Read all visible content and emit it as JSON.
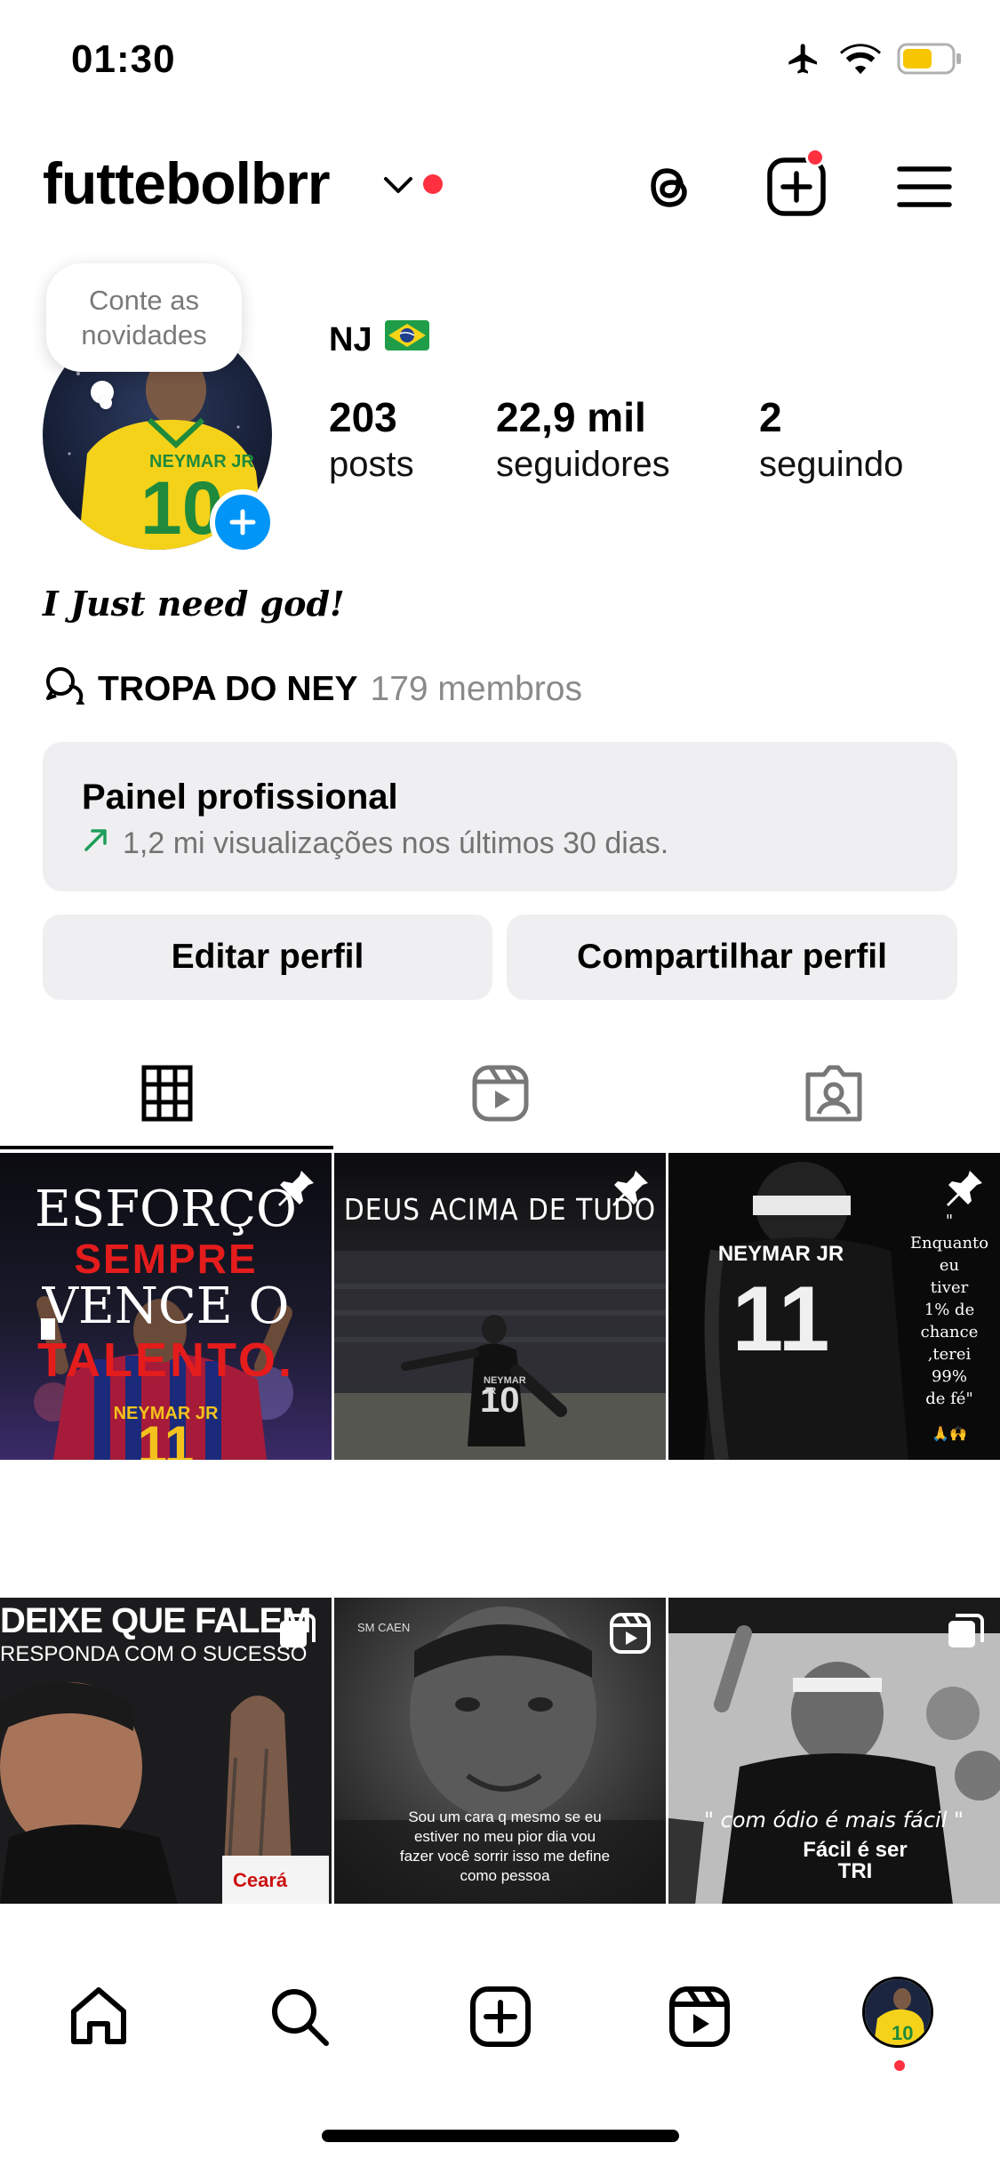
{
  "status_bar": {
    "time": "01:30",
    "icons": [
      "airplane-icon",
      "wifi-icon",
      "battery-icon"
    ],
    "battery_color": "#f7c600"
  },
  "header": {
    "username": "futtebolbrr",
    "icons": [
      "threads-icon",
      "create-icon",
      "menu-icon"
    ],
    "notification_color": "#ff3040"
  },
  "profile": {
    "note_line1": "Conte as",
    "note_line2": "novidades",
    "display_name": "NJ",
    "flag": "🇧🇷",
    "stats": [
      {
        "value": "203",
        "label": "posts"
      },
      {
        "value": "22,9 mil",
        "label": "seguidores"
      },
      {
        "value": "2",
        "label": "seguindo"
      }
    ],
    "bio": "I Just need god!",
    "channel": {
      "name": "TROPA DO NEY",
      "members": "179 membros"
    }
  },
  "dashboard": {
    "title": "Painel profissional",
    "subtitle": "1,2 mi visualizações nos últimos 30 dias."
  },
  "actions": {
    "edit": "Editar perfil",
    "share": "Compartilhar perfil"
  },
  "tabs": [
    "grid-icon",
    "reels-icon",
    "tagged-icon"
  ],
  "grid": {
    "post1": {
      "line1": "ESFORÇO",
      "line2": "SEMPRE",
      "line3": "VENCE O",
      "line4": "TALENTO.",
      "jersey": "NEYMAR JR",
      "number": "11",
      "badge": "pin-icon"
    },
    "post2": {
      "line1": "DEUS ACIMA DE TUDO",
      "jersey": "NEYMAR JR",
      "number": "10",
      "badge": "pin-icon"
    },
    "post3": {
      "quote_lines": [
        "\" Enquanto",
        "eu",
        "tiver",
        "1% de",
        "chance",
        ",terei",
        "99%",
        "de fé\""
      ],
      "emoji": "🙏🙌",
      "jersey": "NEYMAR JR",
      "number": "11",
      "badge": "pin-icon"
    },
    "post4": {
      "line1": "DEIXE QUE FALEM",
      "line2": "RESPONDA COM O SUCESSO",
      "badge": "carousel-icon"
    },
    "post5": {
      "caption": "SM CAEN",
      "quote": "Sou um cara q mesmo se eu estiver no meu pior dia vou fazer você sorrir isso me define como pessoa",
      "badge": "reel-icon"
    },
    "post6": {
      "quote": "\" com ódio é mais fácil \"",
      "shirt": "Fácil é ser TRI",
      "badge": "carousel-icon"
    }
  },
  "bottom_nav": [
    "home-icon",
    "search-icon",
    "create-icon",
    "reels-icon",
    "profile-avatar"
  ]
}
